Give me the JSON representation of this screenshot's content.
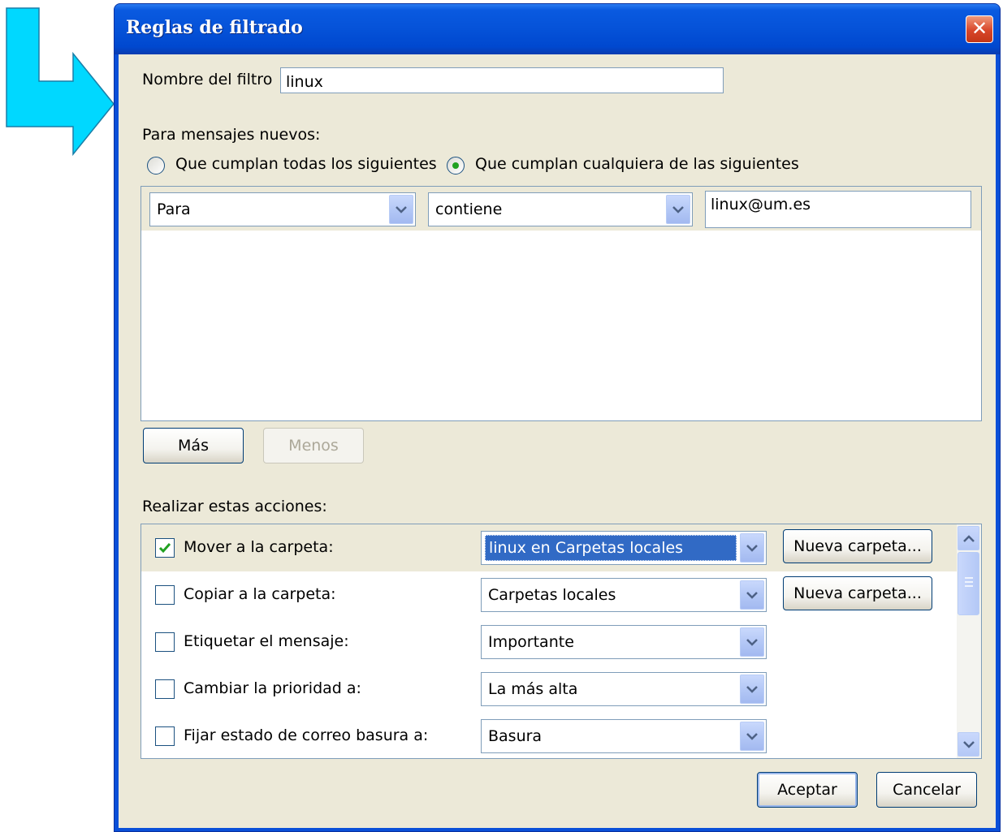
{
  "window": {
    "title": "Reglas de filtrado",
    "close_glyph": "✕"
  },
  "filter_name": {
    "label": "Nombre del filtro",
    "value": "linux"
  },
  "new_messages": {
    "label": "Para mensajes nuevos:",
    "match_all": "Que cumplan todas los siguientes",
    "match_any": "Que cumplan cualquiera de las siguientes",
    "selected": "match_any"
  },
  "rule": {
    "field": "Para",
    "operator": "contiene",
    "value": "linux@um.es"
  },
  "rule_buttons": {
    "more": "Más",
    "less": "Menos"
  },
  "actions": {
    "label": "Realizar estas acciones:",
    "new_folder": "Nueva carpeta...",
    "items": [
      {
        "label": "Mover a la carpeta:",
        "checked": true,
        "value": "linux en Carpetas locales"
      },
      {
        "label": "Copiar a la carpeta:",
        "checked": false,
        "value": "Carpetas locales"
      },
      {
        "label": "Etiquetar el mensaje:",
        "checked": false,
        "value": "Importante"
      },
      {
        "label": "Cambiar la prioridad a:",
        "checked": false,
        "value": "La más alta"
      },
      {
        "label": "Fijar estado de correo basura a:",
        "checked": false,
        "value": "Basura"
      }
    ]
  },
  "footer": {
    "ok": "Aceptar",
    "cancel": "Cancelar"
  },
  "colors": {
    "arrow": "#00d8ff",
    "titlebar": "#0a5ae0",
    "face": "#ece9d8",
    "selection": "#316ac5"
  }
}
